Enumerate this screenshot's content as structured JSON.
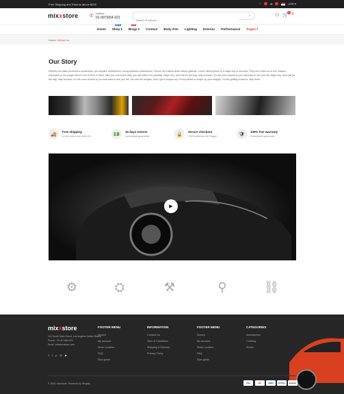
{
  "topbar": {
    "message": "Free Shipping and Returns above $200"
  },
  "header": {
    "logo": {
      "main": "mix",
      "accent": "x",
      "rest": "store"
    },
    "hotline_label": "Hotline:",
    "hotline_number": "01-997)654-321",
    "search_placeholder": "Search Products...",
    "wishlist_count": "0",
    "cart_count": "0"
  },
  "nav": {
    "items": [
      "Home",
      "Shop",
      "Blogs",
      "Contact",
      "Body Kits",
      "Lighting",
      "Exterior",
      "Performance",
      "Pages"
    ],
    "shop_tag": "SALE",
    "blogs_tag": "HOT"
  },
  "breadcrumb": {
    "home": "Home",
    "current": "About Us"
  },
  "story": {
    "title": "Our Story",
    "body": "Eberlies est ullam processes consectetur, qui sequitur molestiorem consectutudum molestiorum. Rerum est culticis quam illisum gallicae. Lorem fished ipsum is a major key to success. They don't want us to win. Always remember in the jungle there's a lot of they in there, after you overcome they, you will make it to paradise. Major key, don't fall for the trap, stay focused. It's the ones closest to you that want to see you fail. Major key, don't fall for the trap, stay focused. It's the ones closest to you that want to see you fail. You see the hedges, how I got it shaped up? It's important to shape up your hedges, it's like getting a haircut, stay fresh."
  },
  "features": [
    {
      "icon": "truck-icon",
      "title": "Free shipping",
      "subtitle": "on all orders over $200.00"
    },
    {
      "icon": "money-icon",
      "title": "15 days returns",
      "subtitle": "moneyback guarantee"
    },
    {
      "icon": "lock-icon",
      "title": "Secure checkout",
      "subtitle": "100% protected by Paypal"
    },
    {
      "icon": "shield-icon",
      "title": "100% free warranty",
      "subtitle": "moneyback guarantee"
    }
  ],
  "footer": {
    "logo": {
      "main": "mix",
      "accent": "x",
      "rest": "store"
    },
    "contact": {
      "address": "123 South Main Street, Los Angeles United States",
      "phone": "Phone: +01-87-654-321",
      "email": "Email: Infomixxstore.com"
    },
    "columns": [
      {
        "heading": "FOOTER MENU",
        "items": [
          "Search",
          "My account",
          "Store Location",
          "FAQ",
          "Size guide"
        ]
      },
      {
        "heading": "INFORMATION",
        "items": [
          "Contact Us",
          "Term & Conditions",
          "Shipping & Delivery",
          "Privacy Policy"
        ]
      },
      {
        "heading": "FOOTER MENU",
        "items": [
          "Search",
          "My account",
          "Store Location",
          "FAQ",
          "Size guide"
        ]
      },
      {
        "heading": "CATEGORIES",
        "items": [
          "Accessories",
          "Clothing",
          "Shoes"
        ]
      }
    ],
    "copyright": "© 2021 mixxstore. Powered by Shopify",
    "payments": [
      "VISA",
      "MC",
      "AMEX",
      "PAYPAL",
      "amazon"
    ]
  },
  "colors": {
    "accent": "#e33333",
    "dark": "#1f1f1f",
    "footer": "#262626"
  }
}
